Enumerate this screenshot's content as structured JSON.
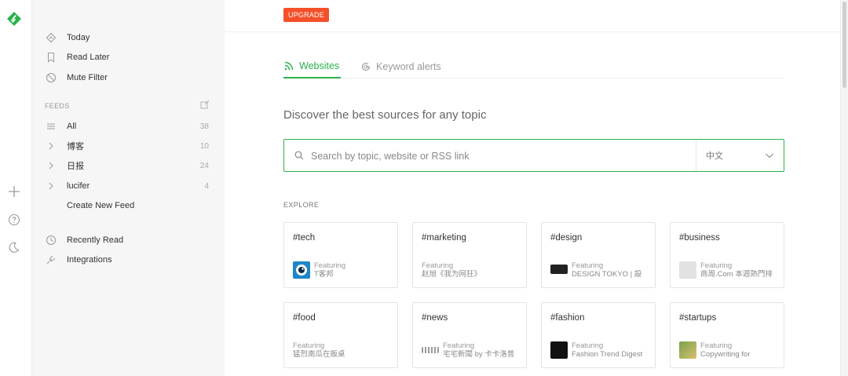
{
  "sidebar": {
    "nav": [
      {
        "label": "Today",
        "icon": "today-icon"
      },
      {
        "label": "Read Later",
        "icon": "bookmark-icon"
      },
      {
        "label": "Mute Filter",
        "icon": "mute-icon"
      }
    ],
    "feeds_label": "FEEDS",
    "feeds": [
      {
        "label": "All",
        "count": "38",
        "icon": "list-icon"
      },
      {
        "label": "博客",
        "count": "10",
        "icon": "chevron-right-icon"
      },
      {
        "label": "日报",
        "count": "24",
        "icon": "chevron-right-icon"
      },
      {
        "label": "lucifer",
        "count": "4",
        "icon": "chevron-right-icon"
      }
    ],
    "create_feed": "Create New Feed",
    "bottom": [
      {
        "label": "Recently Read",
        "icon": "clock-icon"
      },
      {
        "label": "Integrations",
        "icon": "plug-icon"
      }
    ]
  },
  "topbar": {
    "upgrade_label": "UPGRADE"
  },
  "tabs": [
    {
      "label": "Websites",
      "active": true
    },
    {
      "label": "Keyword alerts",
      "active": false
    }
  ],
  "discover_title": "Discover the best sources for any topic",
  "search": {
    "placeholder": "Search by topic, website or RSS link",
    "language": "中文"
  },
  "explore_label": "EXPLORE",
  "cards": [
    {
      "tag": "#tech",
      "featuring": "Featuring",
      "source": "T客邦"
    },
    {
      "tag": "#marketing",
      "featuring": "Featuring",
      "source": "赵旭《我为网狂》"
    },
    {
      "tag": "#design",
      "featuring": "Featuring",
      "source": "DESIGN TOKYO | 設"
    },
    {
      "tag": "#business",
      "featuring": "Featuring",
      "source": "商周.Com 本週熱門排"
    },
    {
      "tag": "#food",
      "featuring": "Featuring",
      "source": "猛烈南瓜在飯桌"
    },
    {
      "tag": "#news",
      "featuring": "Featuring",
      "source": "宅宅新聞 by 卡卡洛普"
    },
    {
      "tag": "#fashion",
      "featuring": "Featuring",
      "source": "Fashion Trend Digest"
    },
    {
      "tag": "#startups",
      "featuring": "Featuring",
      "source": "Copywriting for"
    }
  ],
  "colors": {
    "accent": "#2bb24c",
    "upgrade": "#f5502a",
    "sidebar_bg": "#f6f6f6"
  }
}
